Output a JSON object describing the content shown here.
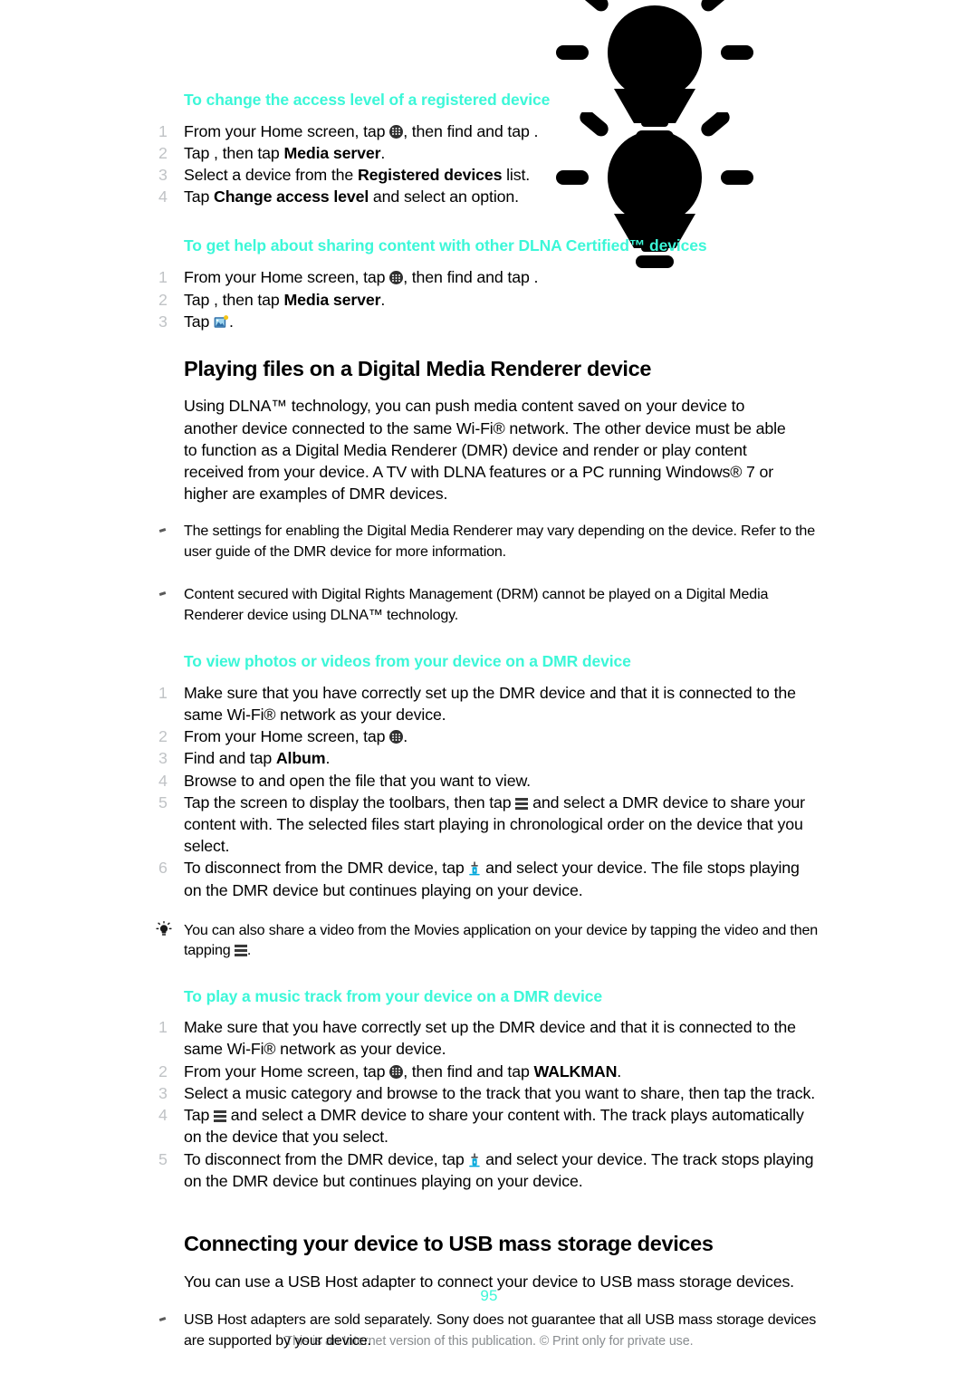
{
  "document": {
    "page_number": "95",
    "footer_note": "This is an Internet version of this publication. © Print only for private use.",
    "heading_color": "#3cf7d8",
    "body_color": "#000000",
    "step_number_color": "#c0c3c6",
    "footer_color": "#898d90"
  },
  "sections": [
    {
      "id": "change-access-level",
      "heading": "To change the access level of a registered device",
      "steps": [
        {
          "num": "1",
          "parts": [
            {
              "t": "text",
              "v": "From your Home screen, tap "
            },
            {
              "t": "icon",
              "v": "app-drawer-icon"
            },
            {
              "t": "text",
              "v": ", then find and tap    ."
            }
          ]
        },
        {
          "num": "2",
          "parts": [
            {
              "t": "text",
              "v": "Tap  , then tap "
            },
            {
              "t": "bold",
              "v": "Media server"
            },
            {
              "t": "text",
              "v": "."
            }
          ]
        },
        {
          "num": "3",
          "parts": [
            {
              "t": "text",
              "v": "Select a device from the "
            },
            {
              "t": "bold",
              "v": "Registered devices"
            },
            {
              "t": "text",
              "v": " list."
            }
          ]
        },
        {
          "num": "4",
          "parts": [
            {
              "t": "text",
              "v": "Tap "
            },
            {
              "t": "bold",
              "v": "Change access level"
            },
            {
              "t": "text",
              "v": " and select an option."
            }
          ]
        }
      ]
    },
    {
      "id": "get-help-sharing",
      "heading": "To get help about sharing content with other DLNA Certified™ devices",
      "steps": [
        {
          "num": "1",
          "parts": [
            {
              "t": "text",
              "v": "From your Home screen, tap "
            },
            {
              "t": "icon",
              "v": "app-drawer-icon"
            },
            {
              "t": "text",
              "v": ", then find and tap   ."
            }
          ]
        },
        {
          "num": "2",
          "parts": [
            {
              "t": "text",
              "v": "Tap , then tap "
            },
            {
              "t": "bold",
              "v": "Media server"
            },
            {
              "t": "text",
              "v": "."
            }
          ]
        },
        {
          "num": "3",
          "parts": [
            {
              "t": "text",
              "v": "Tap "
            },
            {
              "t": "icon",
              "v": "help-image-icon"
            },
            {
              "t": "text",
              "v": "."
            }
          ]
        }
      ]
    }
  ],
  "chapter1": {
    "title": "Playing files on a Digital Media Renderer device",
    "intro": "Using DLNA™ technology, you can push media content saved on your device to another device connected to the same Wi-Fi® network. The other device must be able to function as a Digital Media Renderer (DMR) device and render or play content received from your device. A TV with DLNA features or a PC running Windows® 7 or higher are examples of DMR devices.",
    "notes": [
      "The settings for enabling the Digital Media Renderer may vary depending on the device. Refer to the user guide of the DMR device for more information.",
      "Content secured with Digital Rights Management (DRM) cannot be played on a Digital Media Renderer device using DLNA™ technology."
    ]
  },
  "dmr_view": {
    "heading": "To view photos or videos from your device on a DMR device",
    "steps": [
      {
        "num": "1",
        "parts": [
          {
            "t": "text",
            "v": "Make sure that you have correctly set up the DMR device and that it is connected to the same Wi-Fi® network as your device."
          }
        ]
      },
      {
        "num": "2",
        "parts": [
          {
            "t": "text",
            "v": "From your Home screen, tap "
          },
          {
            "t": "icon",
            "v": "app-drawer-icon"
          },
          {
            "t": "text",
            "v": "."
          }
        ]
      },
      {
        "num": "3",
        "parts": [
          {
            "t": "text",
            "v": "Find and tap "
          },
          {
            "t": "bold",
            "v": "Album"
          },
          {
            "t": "text",
            "v": "."
          }
        ]
      },
      {
        "num": "4",
        "parts": [
          {
            "t": "text",
            "v": "Browse to and open the file that you want to view."
          }
        ]
      },
      {
        "num": "5",
        "parts": [
          {
            "t": "text",
            "v": "Tap the screen to display the toolbars, then tap "
          },
          {
            "t": "icon",
            "v": "list-icon"
          },
          {
            "t": "text",
            "v": " and select a DMR device to share your content with. The selected files start playing in chronological order on the device that you select."
          }
        ]
      },
      {
        "num": "6",
        "parts": [
          {
            "t": "text",
            "v": "To disconnect from the DMR device, tap "
          },
          {
            "t": "icon",
            "v": "throw-icon"
          },
          {
            "t": "text",
            "v": " and select your device. The file stops playing on the DMR device but continues playing on your device."
          }
        ]
      }
    ],
    "tip": [
      {
        "t": "text",
        "v": "You can also share a video from the Movies application on your device by tapping the video and then tapping "
      },
      {
        "t": "icon",
        "v": "list-icon"
      },
      {
        "t": "text",
        "v": "."
      }
    ]
  },
  "dmr_music": {
    "heading": "To play a music track from your device on a DMR device",
    "steps": [
      {
        "num": "1",
        "parts": [
          {
            "t": "text",
            "v": "Make sure that you have correctly set up the DMR device and that it is connected to the same Wi-Fi® network as your device."
          }
        ]
      },
      {
        "num": "2",
        "parts": [
          {
            "t": "text",
            "v": "From your Home screen, tap "
          },
          {
            "t": "icon",
            "v": "app-drawer-icon"
          },
          {
            "t": "text",
            "v": ", then find and tap "
          },
          {
            "t": "bold",
            "v": "WALKMAN"
          },
          {
            "t": "text",
            "v": "."
          }
        ]
      },
      {
        "num": "3",
        "parts": [
          {
            "t": "text",
            "v": "Select a music category and browse to the track that you want to share, then tap the track."
          }
        ]
      },
      {
        "num": "4",
        "parts": [
          {
            "t": "text",
            "v": "Tap "
          },
          {
            "t": "icon",
            "v": "list-icon"
          },
          {
            "t": "text",
            "v": " and select a DMR device to share your content with. The track plays automatically on the device that you select."
          }
        ]
      },
      {
        "num": "5",
        "parts": [
          {
            "t": "text",
            "v": "To disconnect from the DMR device, tap "
          },
          {
            "t": "icon",
            "v": "throw-icon"
          },
          {
            "t": "text",
            "v": " and select your device. The track stops playing on the DMR device but continues playing on your device."
          }
        ]
      }
    ]
  },
  "chapter2": {
    "title": "Connecting your device to USB mass storage devices",
    "intro": "You can use a USB Host adapter to connect your device to USB mass storage devices.",
    "notes": [
      "USB Host adapters are sold separately. Sony does not guarantee that all USB mass storage devices are supported by your device."
    ]
  }
}
